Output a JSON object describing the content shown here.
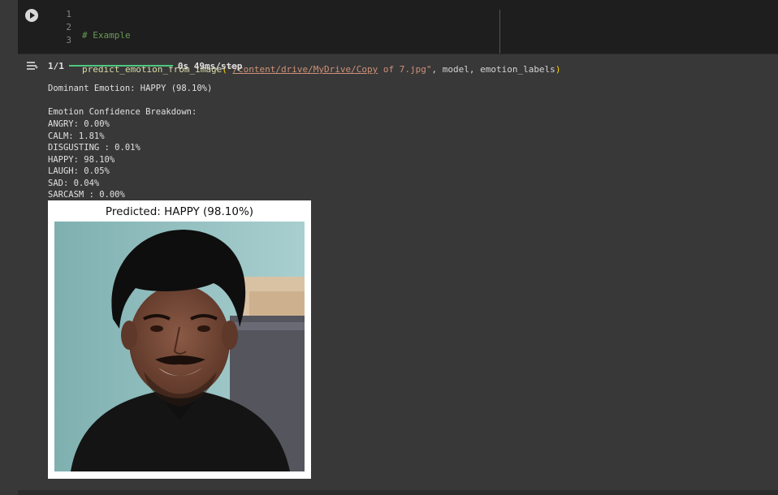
{
  "cell": {
    "line_numbers": [
      "1",
      "2",
      "3"
    ],
    "comment": "# Example",
    "fn_name": "predict_emotion_from_image",
    "paren_open": "(",
    "str_quote_open": "\"",
    "str_path_link": "/content/drive/MyDrive/Copy",
    "str_path_rest": " of 7.jpg",
    "str_quote_close": "\"",
    "args": ", model, emotion_labels",
    "paren_close": ")"
  },
  "progress": {
    "step": "1/1",
    "fraction": 1.0,
    "timing": "0s 49ms/step",
    "color": "#4ec97f"
  },
  "output_text": {
    "dominant": "Dominant Emotion: HAPPY (98.10%)",
    "breakdown_header": "Emotion Confidence Breakdown:",
    "lines": [
      "ANGRY: 0.00%",
      "CALM: 1.81%",
      "DISGUSTING : 0.01%",
      "HAPPY: 98.10%",
      "LAUGH: 0.05%",
      "SAD: 0.04%",
      "SARCASM : 0.00%"
    ]
  },
  "figure": {
    "title": "Predicted: HAPPY (98.10%)"
  }
}
